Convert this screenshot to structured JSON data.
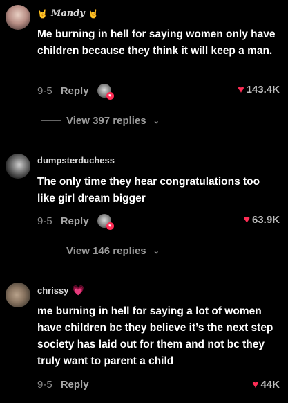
{
  "comments": [
    {
      "username": "Mandy",
      "username_deco_left": "🤘",
      "username_deco_right": "🤘",
      "text": "Me burning in hell for saying women only have children because they think it will keep a man.",
      "date": "9-5",
      "reply_label": "Reply",
      "likes": "143.4K",
      "view_replies": "View 397 replies"
    },
    {
      "username": "dumpsterduchess",
      "text": "The only time they hear congratulations too like girl dream bigger",
      "date": "9-5",
      "reply_label": "Reply",
      "likes": "63.9K",
      "view_replies": "View 146 replies"
    },
    {
      "username": "chrissy",
      "username_badge": "💗",
      "text": "me burning in hell for saying a lot of women have children bc they believe it’s the next step society has laid out for them and not bc they truly want to parent a child",
      "date": "9-5",
      "reply_label": "Reply",
      "likes": "44K"
    }
  ],
  "colors": {
    "background": "#000000",
    "heart": "#ff2d55",
    "meta_text": "#8c8c8c"
  },
  "icons": {
    "like": "heart-icon",
    "expand": "chevron-down-icon",
    "creator_liked": "creator-liked-avatar"
  }
}
